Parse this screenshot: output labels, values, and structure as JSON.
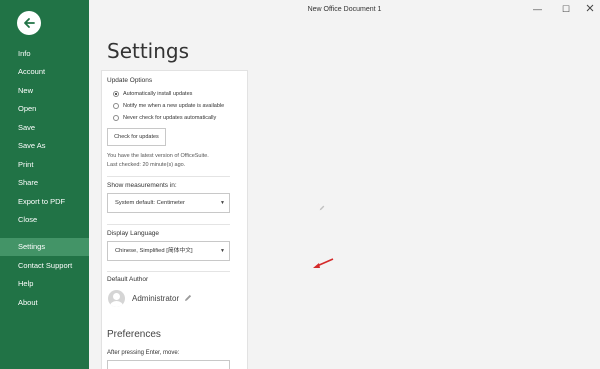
{
  "window": {
    "title": "New Office Document 1",
    "minimize_glyph": "—",
    "maximize_glyph": "☐"
  },
  "sidebar": {
    "back_icon": "back-arrow-icon",
    "items": [
      {
        "label": "Info"
      },
      {
        "label": "Account"
      },
      {
        "label": "New"
      },
      {
        "label": "Open"
      },
      {
        "label": "Save"
      },
      {
        "label": "Save As"
      },
      {
        "label": "Print"
      },
      {
        "label": "Share"
      },
      {
        "label": "Export to PDF"
      },
      {
        "label": "Close"
      },
      {
        "label": "Settings",
        "active": true
      },
      {
        "label": "Contact Support"
      },
      {
        "label": "Help"
      },
      {
        "label": "About"
      }
    ]
  },
  "main": {
    "title": "Settings",
    "update": {
      "heading": "Update Options",
      "options": [
        {
          "label": "Automatically install updates",
          "checked": true
        },
        {
          "label": "Notify me when a new update is available",
          "checked": false
        },
        {
          "label": "Never check for updates automatically",
          "checked": false
        }
      ],
      "check_button": "Check for updates",
      "status_line1": "You have the latest version of OfficeSuite.",
      "status_line2": "Last checked: 20 minute(s) ago."
    },
    "measurements": {
      "label": "Show measurements in:",
      "value": "System default: Centimeter"
    },
    "language": {
      "label": "Display Language",
      "value": "Chinese, Simplified [简体中文]"
    },
    "author": {
      "label": "Default Author",
      "name": "Administrator"
    },
    "preferences": {
      "heading": "Preferences",
      "after_enter_label": "After pressing Enter, move:"
    }
  },
  "colors": {
    "sidebar_bg": "#217346",
    "sidebar_active": "#439467",
    "annotation_arrow": "#d42a2a"
  }
}
